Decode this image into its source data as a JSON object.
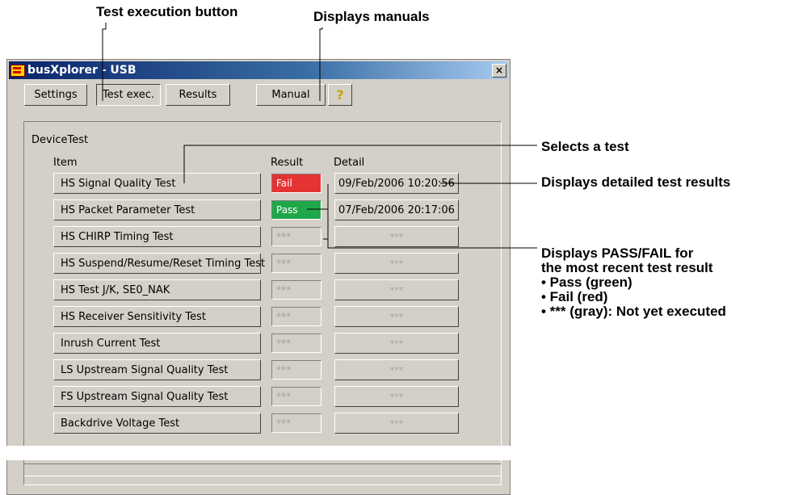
{
  "annotations": {
    "test_exec_button": "Test execution button",
    "displays_manuals": "Displays manuals",
    "selects_test": "Selects a test",
    "displays_detailed": "Displays detailed test results",
    "pass_fail_line1": "Displays PASS/FAIL for",
    "pass_fail_line2": "the most recent test result",
    "bullets": [
      "• Pass (green)",
      "• Fail (red)",
      "• *** (gray): Not yet executed"
    ]
  },
  "window": {
    "title": "busXplorer - USB",
    "close_label": "×"
  },
  "tabs": {
    "settings": "Settings",
    "test_exec": "Test exec.",
    "results": "Results",
    "manual": "Manual",
    "help": "?"
  },
  "section": {
    "label": "DeviceTest",
    "col_item": "Item",
    "col_result": "Result",
    "col_detail": "Detail"
  },
  "tests": [
    {
      "item": "HS Signal Quality Test",
      "result": "Fail",
      "status": "fail",
      "detail": "09/Feb/2006 10:20:56"
    },
    {
      "item": "HS Packet Parameter Test",
      "result": "Pass",
      "status": "pass",
      "detail": "07/Feb/2006 20:17:06"
    },
    {
      "item": "HS CHIRP Timing Test",
      "result": "***",
      "status": "none",
      "detail": "***"
    },
    {
      "item": "HS Suspend/Resume/Reset Timing Test",
      "result": "***",
      "status": "none",
      "detail": "***"
    },
    {
      "item": "HS Test J/K, SE0_NAK",
      "result": "***",
      "status": "none",
      "detail": "***"
    },
    {
      "item": "HS Receiver Sensitivity Test",
      "result": "***",
      "status": "none",
      "detail": "***"
    },
    {
      "item": "Inrush Current Test",
      "result": "***",
      "status": "none",
      "detail": "***"
    },
    {
      "item": "LS Upstream Signal Quality Test",
      "result": "***",
      "status": "none",
      "detail": "***"
    },
    {
      "item": "FS Upstream Signal Quality Test",
      "result": "***",
      "status": "none",
      "detail": "***"
    },
    {
      "item": "Backdrive Voltage Test",
      "result": "***",
      "status": "none",
      "detail": "***"
    }
  ],
  "colors": {
    "fail": "#e53333",
    "pass": "#1fa84a",
    "window_bg": "#d4d0c8"
  }
}
